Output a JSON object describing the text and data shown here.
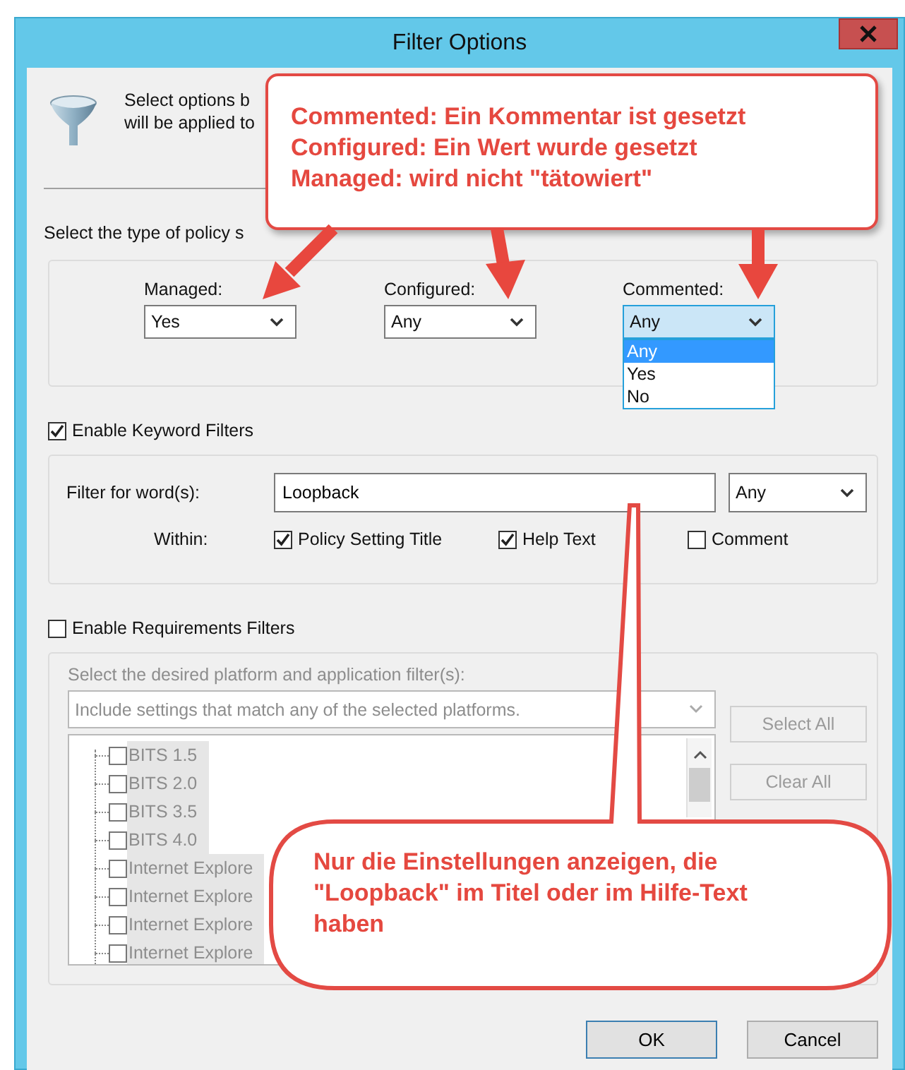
{
  "window": {
    "title": "Filter Options"
  },
  "intro": {
    "lines": [
      "Select options b",
      "will be applied to"
    ]
  },
  "policy_type": {
    "label": "Select the type of policy s",
    "filters": [
      {
        "label": "Managed:",
        "value": "Yes",
        "open": false
      },
      {
        "label": "Configured:",
        "value": "Any",
        "open": false
      },
      {
        "label": "Commented:",
        "value": "Any",
        "open": true,
        "options": [
          {
            "label": "Any",
            "selected": true
          },
          {
            "label": "Yes",
            "selected": false
          },
          {
            "label": "No",
            "selected": false
          }
        ]
      }
    ]
  },
  "keyword": {
    "label": "Enable Keyword Filters",
    "checked": true,
    "word_label": "Filter for word(s):",
    "word": "Loopback",
    "match": "Any",
    "within_label": "Within:",
    "within": [
      {
        "label": "Policy Setting Title",
        "checked": true
      },
      {
        "label": "Help Text",
        "checked": true
      },
      {
        "label": "Comment",
        "checked": false
      }
    ]
  },
  "requirements": {
    "label": "Enable Requirements Filters",
    "checked": false,
    "disabled": true,
    "hint": "Select the desired platform and application filter(s):",
    "mode": "Include settings that match any of the selected platforms.",
    "platforms": [
      {
        "label": "BITS 1.5",
        "checked": false
      },
      {
        "label": "BITS 2.0",
        "checked": false
      },
      {
        "label": "BITS 3.5",
        "checked": false
      },
      {
        "label": "BITS 4.0",
        "checked": false
      },
      {
        "label": "Internet Explore",
        "checked": false
      },
      {
        "label": "Internet Explore",
        "checked": false
      },
      {
        "label": "Internet Explore",
        "checked": false
      },
      {
        "label": "Internet Explore",
        "checked": false
      }
    ],
    "buttons": [
      "Select All",
      "Clear All"
    ]
  },
  "buttons": [
    {
      "label": "OK",
      "default": true
    },
    {
      "label": "Cancel",
      "default": false
    }
  ],
  "callouts": [
    {
      "lines": [
        "Commented: Ein Kommentar ist gesetzt",
        "Configured: Ein Wert wurde gesetzt",
        "Managed: wird nicht \"tätowiert\""
      ]
    },
    {
      "lines": [
        "Nur die Einstellungen anzeigen, die",
        "\"Loopback\" im Titel oder im Hilfe-Text",
        "haben"
      ]
    }
  ]
}
